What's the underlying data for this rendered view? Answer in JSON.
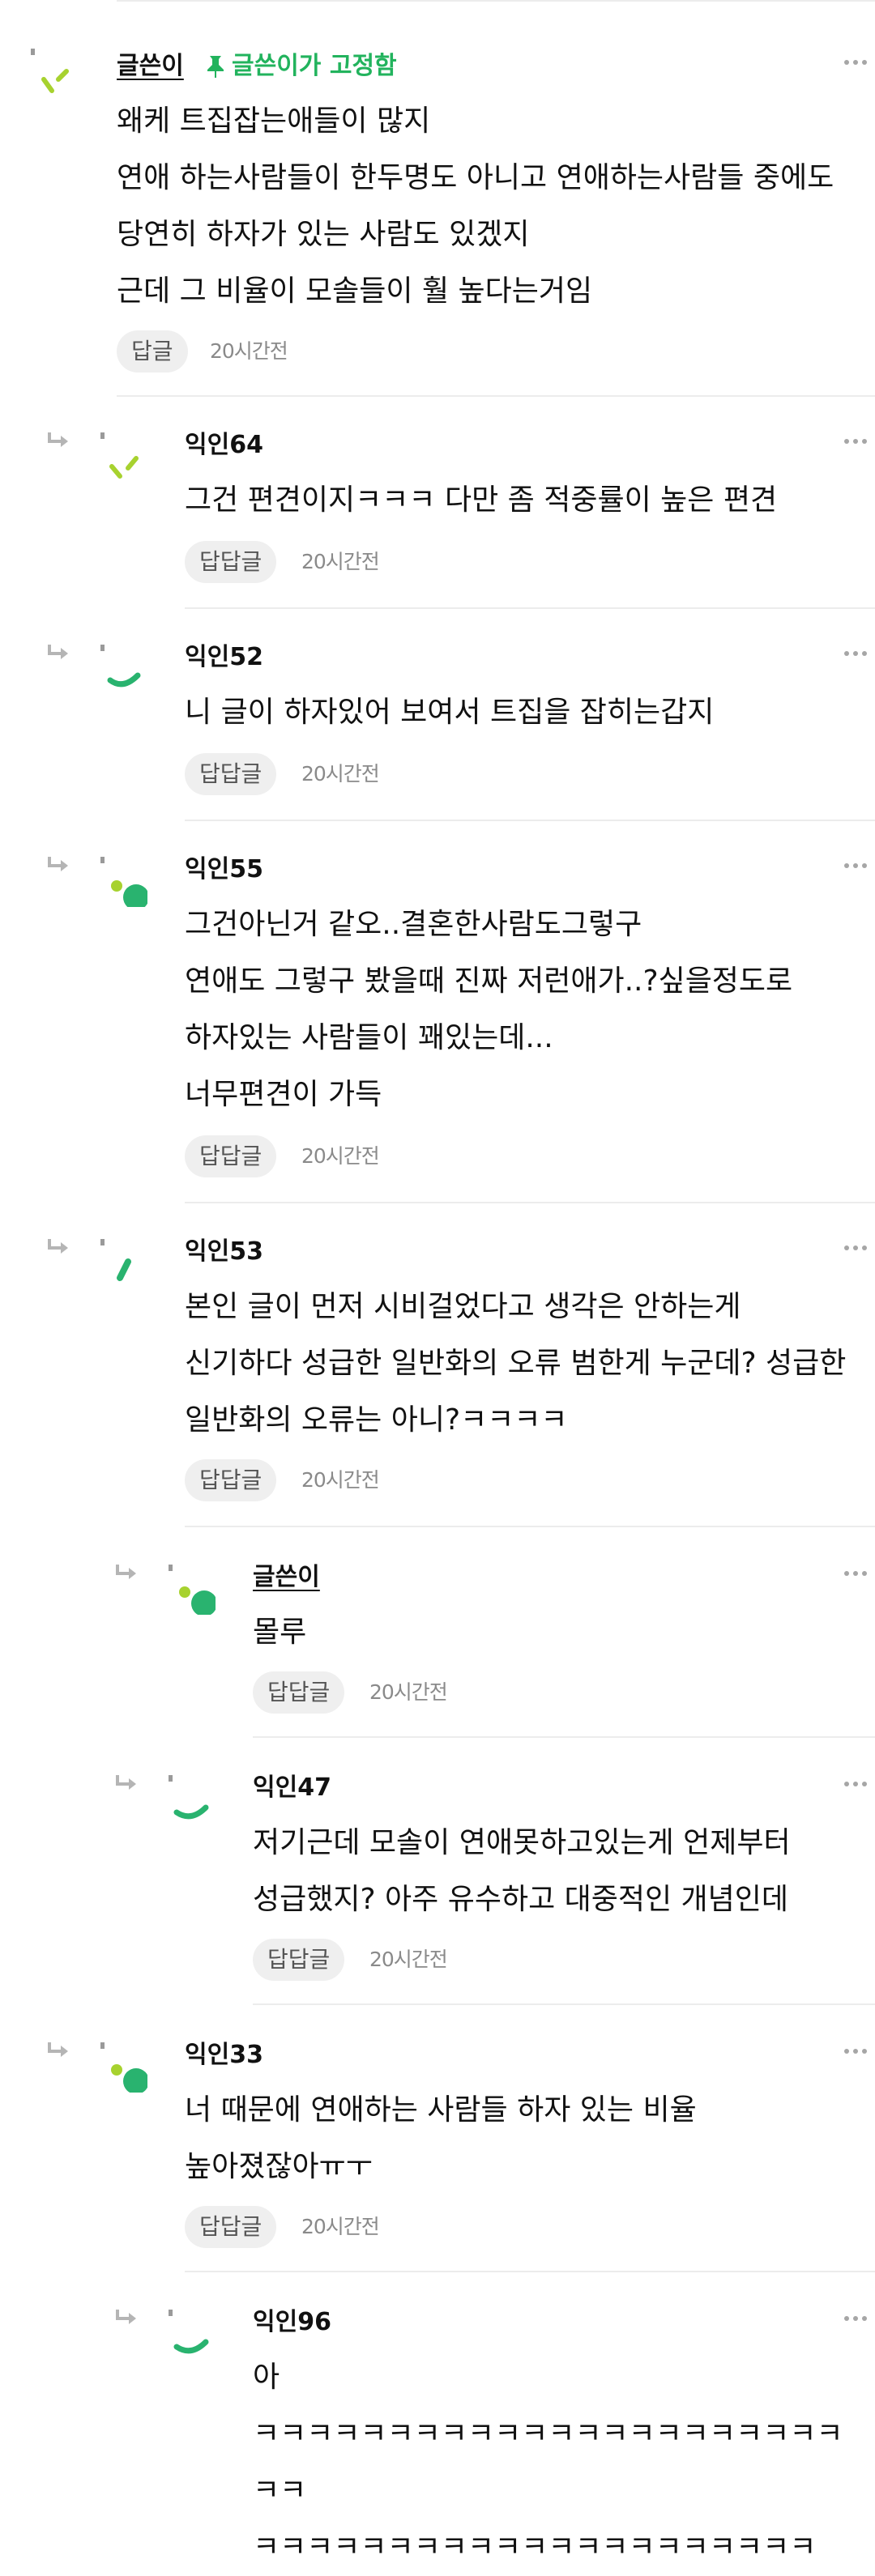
{
  "colors": {
    "accent_green": "#22b35d",
    "avatar_green": "#29b36f",
    "avatar_lime": "#a7d22f",
    "arrow_gray": "#b5b5b5"
  },
  "comments": [
    {
      "author": "글쓴이",
      "pin_label": "글쓴이가 고정함",
      "text": "왜케 트집잡는애들이 많지\n연애 하는사람들이 한두명도 아니고 연애하는사람들 중에도 당연히 하자가 있는 사람도 있겠지\n근데 그 비율이 모솔들이 훨 높다는거임",
      "reply_label": "답글",
      "time": "20시간전",
      "avatar_icon": "lime-slash-avatar-icon"
    },
    {
      "author": "익인64",
      "text": "그건 편견이지ㅋㅋㅋ 다만 좀 적중률이 높은 편견",
      "reply_label": "답답글",
      "time": "20시간전",
      "avatar_icon": "lime-slash-avatar-icon"
    },
    {
      "author": "익인52",
      "text": "니 글이 하자있어 보여서 트집을 잡히는갑지",
      "reply_label": "답답글",
      "time": "20시간전",
      "avatar_icon": "green-arc-avatar-icon"
    },
    {
      "author": "익인55",
      "text": "그건아닌거 같오..결혼한사람도그렇구\n연애도 그렇구 봤을때 진짜 저런애가..?싶을정도로 하자있는 사람들이 꽤있는데...\n너무편견이 가득",
      "reply_label": "답답글",
      "time": "20시간전",
      "avatar_icon": "green-dot-avatar-icon"
    },
    {
      "author": "익인53",
      "text": "본인 글이 먼저 시비걸었다고 생각은 안하는게 신기하다 성급한 일반화의 오류 범한게 누군데? 성급한 일반화의 오류는 아니?ㅋㅋㅋㅋ",
      "reply_label": "답답글",
      "time": "20시간전",
      "avatar_icon": "green-slash-avatar-icon"
    },
    {
      "author": "글쓴이",
      "text": "몰루",
      "reply_label": "답답글",
      "time": "20시간전",
      "avatar_icon": "green-dot-avatar-icon"
    },
    {
      "author": "익인47",
      "text": "저기근데 모솔이 연애못하고있는게 언제부터 성급했지? 아주 유수하고 대중적인 개념인데",
      "reply_label": "답답글",
      "time": "20시간전",
      "avatar_icon": "green-arc-avatar-icon"
    },
    {
      "author": "익인33",
      "text": "너 때문에 연애하는 사람들 하자 있는 비율 높아졌잖아ㅠㅜ",
      "reply_label": "답답글",
      "time": "20시간전",
      "avatar_icon": "green-dot-avatar-icon"
    },
    {
      "author": "익인96",
      "text": "아 ㅋㅋㅋㅋㅋㅋㅋㅋㅋㅋㅋㅋㅋㅋㅋㅋㅋㅋㅋㅋㅋㅋㅋㅋ ㅋㅋㅋㅋㅋㅋㅋㅋㅋㅋㅋㅋㅋㅋㅋㅋㅋㅋㅋㅋㅋ",
      "avatar_icon": "green-arc-avatar-icon"
    }
  ]
}
